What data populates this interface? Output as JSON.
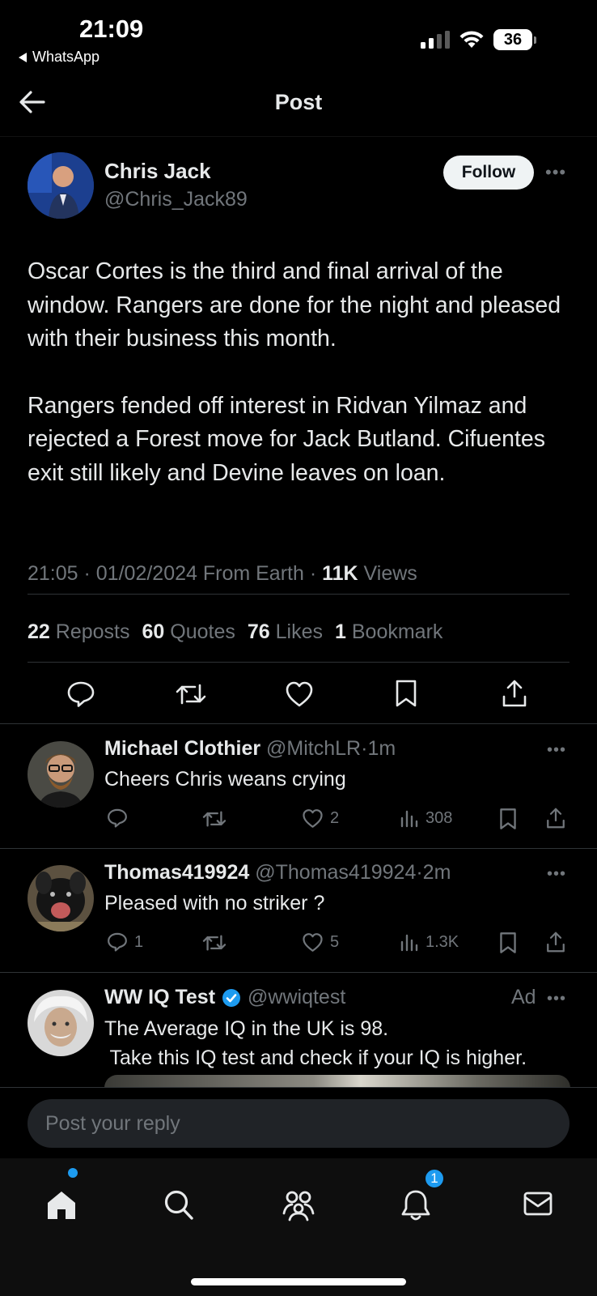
{
  "status_bar": {
    "time": "21:09",
    "back_app": "WhatsApp",
    "battery": "36"
  },
  "header": {
    "title": "Post"
  },
  "post": {
    "author_name": "Chris Jack",
    "author_handle": "@Chris_Jack89",
    "follow_label": "Follow",
    "paragraphs": [
      "Oscar Cortes is the third and final arrival of the window. Rangers are done for the night and pleased with their business this month.",
      "Rangers fended off interest in Ridvan Yilmaz and rejected a Forest move for Jack Butland. Cifuentes exit still likely and Devine leaves on loan."
    ],
    "meta_time": "21:05",
    "meta_date": "01/02/2024",
    "meta_source": "From Earth",
    "views_count": "11K",
    "views_label": "Views",
    "stats": {
      "reposts_count": "22",
      "reposts_label": "Reposts",
      "quotes_count": "60",
      "quotes_label": "Quotes",
      "likes_count": "76",
      "likes_label": "Likes",
      "bookmarks_count": "1",
      "bookmarks_label": "Bookmark"
    }
  },
  "replies": [
    {
      "name": "Michael Clothier",
      "handle": "@MitchLR",
      "time": "1m",
      "text": "Cheers Chris weans crying",
      "replies_count": "",
      "likes_count": "2",
      "views_count": "308"
    },
    {
      "name": "Thomas419924",
      "handle": "@Thomas419924",
      "time": "2m",
      "text": "Pleased with no striker ?",
      "replies_count": "1",
      "likes_count": "5",
      "views_count": "1.3K"
    }
  ],
  "ad": {
    "name": "WW IQ Test",
    "handle": "@wwiqtest",
    "ad_label": "Ad",
    "line1": "The Average IQ in the UK is 98.",
    "line2": " Take this IQ test and check if your IQ is higher."
  },
  "reply_bar": {
    "placeholder": "Post your reply"
  },
  "bottom_nav": {
    "notifications_badge": "1"
  },
  "colors": {
    "background": "#000000",
    "text_primary": "#e7e9ea",
    "text_secondary": "#71767b",
    "divider": "#2f3336",
    "accent_blue": "#1d9bf0"
  }
}
